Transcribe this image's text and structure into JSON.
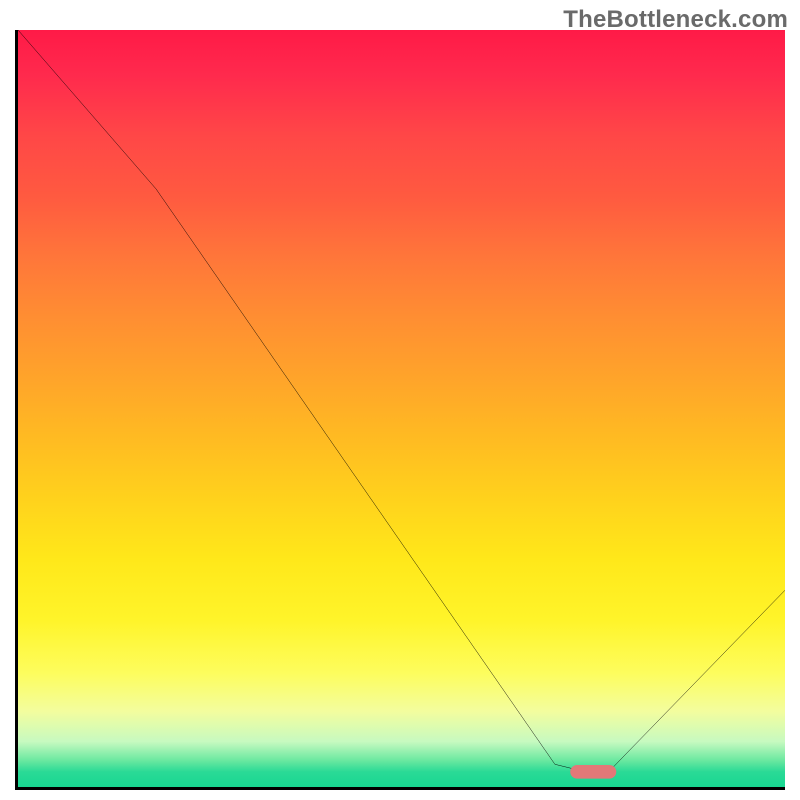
{
  "watermark": "TheBottleneck.com",
  "chart_data": {
    "type": "line",
    "title": "",
    "xlabel": "",
    "ylabel": "",
    "xlim": [
      0,
      100
    ],
    "ylim": [
      0,
      100
    ],
    "grid": false,
    "background_gradient": {
      "top": "#ff1a47",
      "mid": "#ffe81a",
      "bottom": "#18d792"
    },
    "series": [
      {
        "name": "bottleneck-curve",
        "color": "#000000",
        "x": [
          0,
          18,
          70,
          74,
          77,
          100
        ],
        "y": [
          100,
          79,
          3,
          2,
          2,
          26
        ]
      }
    ],
    "optimal_marker": {
      "color": "#e27878",
      "x_range": [
        72,
        78
      ],
      "y": 2,
      "thickness_pct": 1.8
    }
  }
}
